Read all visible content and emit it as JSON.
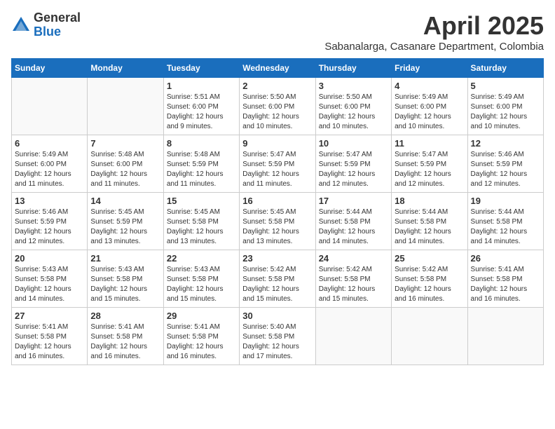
{
  "logo": {
    "general": "General",
    "blue": "Blue"
  },
  "title": "April 2025",
  "subtitle": "Sabanalarga, Casanare Department, Colombia",
  "headers": [
    "Sunday",
    "Monday",
    "Tuesday",
    "Wednesday",
    "Thursday",
    "Friday",
    "Saturday"
  ],
  "weeks": [
    [
      {
        "day": "",
        "info": ""
      },
      {
        "day": "",
        "info": ""
      },
      {
        "day": "1",
        "info": "Sunrise: 5:51 AM\nSunset: 6:00 PM\nDaylight: 12 hours\nand 9 minutes."
      },
      {
        "day": "2",
        "info": "Sunrise: 5:50 AM\nSunset: 6:00 PM\nDaylight: 12 hours\nand 10 minutes."
      },
      {
        "day": "3",
        "info": "Sunrise: 5:50 AM\nSunset: 6:00 PM\nDaylight: 12 hours\nand 10 minutes."
      },
      {
        "day": "4",
        "info": "Sunrise: 5:49 AM\nSunset: 6:00 PM\nDaylight: 12 hours\nand 10 minutes."
      },
      {
        "day": "5",
        "info": "Sunrise: 5:49 AM\nSunset: 6:00 PM\nDaylight: 12 hours\nand 10 minutes."
      }
    ],
    [
      {
        "day": "6",
        "info": "Sunrise: 5:49 AM\nSunset: 6:00 PM\nDaylight: 12 hours\nand 11 minutes."
      },
      {
        "day": "7",
        "info": "Sunrise: 5:48 AM\nSunset: 6:00 PM\nDaylight: 12 hours\nand 11 minutes."
      },
      {
        "day": "8",
        "info": "Sunrise: 5:48 AM\nSunset: 5:59 PM\nDaylight: 12 hours\nand 11 minutes."
      },
      {
        "day": "9",
        "info": "Sunrise: 5:47 AM\nSunset: 5:59 PM\nDaylight: 12 hours\nand 11 minutes."
      },
      {
        "day": "10",
        "info": "Sunrise: 5:47 AM\nSunset: 5:59 PM\nDaylight: 12 hours\nand 12 minutes."
      },
      {
        "day": "11",
        "info": "Sunrise: 5:47 AM\nSunset: 5:59 PM\nDaylight: 12 hours\nand 12 minutes."
      },
      {
        "day": "12",
        "info": "Sunrise: 5:46 AM\nSunset: 5:59 PM\nDaylight: 12 hours\nand 12 minutes."
      }
    ],
    [
      {
        "day": "13",
        "info": "Sunrise: 5:46 AM\nSunset: 5:59 PM\nDaylight: 12 hours\nand 12 minutes."
      },
      {
        "day": "14",
        "info": "Sunrise: 5:45 AM\nSunset: 5:59 PM\nDaylight: 12 hours\nand 13 minutes."
      },
      {
        "day": "15",
        "info": "Sunrise: 5:45 AM\nSunset: 5:58 PM\nDaylight: 12 hours\nand 13 minutes."
      },
      {
        "day": "16",
        "info": "Sunrise: 5:45 AM\nSunset: 5:58 PM\nDaylight: 12 hours\nand 13 minutes."
      },
      {
        "day": "17",
        "info": "Sunrise: 5:44 AM\nSunset: 5:58 PM\nDaylight: 12 hours\nand 14 minutes."
      },
      {
        "day": "18",
        "info": "Sunrise: 5:44 AM\nSunset: 5:58 PM\nDaylight: 12 hours\nand 14 minutes."
      },
      {
        "day": "19",
        "info": "Sunrise: 5:44 AM\nSunset: 5:58 PM\nDaylight: 12 hours\nand 14 minutes."
      }
    ],
    [
      {
        "day": "20",
        "info": "Sunrise: 5:43 AM\nSunset: 5:58 PM\nDaylight: 12 hours\nand 14 minutes."
      },
      {
        "day": "21",
        "info": "Sunrise: 5:43 AM\nSunset: 5:58 PM\nDaylight: 12 hours\nand 15 minutes."
      },
      {
        "day": "22",
        "info": "Sunrise: 5:43 AM\nSunset: 5:58 PM\nDaylight: 12 hours\nand 15 minutes."
      },
      {
        "day": "23",
        "info": "Sunrise: 5:42 AM\nSunset: 5:58 PM\nDaylight: 12 hours\nand 15 minutes."
      },
      {
        "day": "24",
        "info": "Sunrise: 5:42 AM\nSunset: 5:58 PM\nDaylight: 12 hours\nand 15 minutes."
      },
      {
        "day": "25",
        "info": "Sunrise: 5:42 AM\nSunset: 5:58 PM\nDaylight: 12 hours\nand 16 minutes."
      },
      {
        "day": "26",
        "info": "Sunrise: 5:41 AM\nSunset: 5:58 PM\nDaylight: 12 hours\nand 16 minutes."
      }
    ],
    [
      {
        "day": "27",
        "info": "Sunrise: 5:41 AM\nSunset: 5:58 PM\nDaylight: 12 hours\nand 16 minutes."
      },
      {
        "day": "28",
        "info": "Sunrise: 5:41 AM\nSunset: 5:58 PM\nDaylight: 12 hours\nand 16 minutes."
      },
      {
        "day": "29",
        "info": "Sunrise: 5:41 AM\nSunset: 5:58 PM\nDaylight: 12 hours\nand 16 minutes."
      },
      {
        "day": "30",
        "info": "Sunrise: 5:40 AM\nSunset: 5:58 PM\nDaylight: 12 hours\nand 17 minutes."
      },
      {
        "day": "",
        "info": ""
      },
      {
        "day": "",
        "info": ""
      },
      {
        "day": "",
        "info": ""
      }
    ]
  ]
}
